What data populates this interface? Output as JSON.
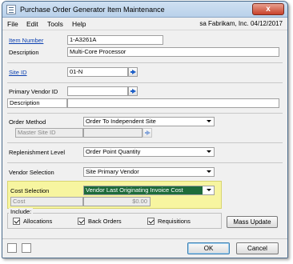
{
  "window": {
    "title": "Purchase Order Generator Item Maintenance",
    "close_label": "x"
  },
  "menu": {
    "items": [
      "File",
      "Edit",
      "Tools",
      "Help"
    ],
    "company_info": "sa  Fabrikam, Inc.  04/12/2017"
  },
  "form": {
    "item_number_label": "Item Number",
    "item_number_value": "1-A3261A",
    "description_label": "Description",
    "description_value": "Multi-Core Processor",
    "site_id_label": "Site ID",
    "site_id_value": "01-N",
    "primary_vendor_label": "Primary Vendor ID",
    "primary_vendor_value": "",
    "vendor_description_label": "Description",
    "vendor_description_value": "",
    "order_method_label": "Order Method",
    "order_method_value": "Order To Independent Site",
    "master_site_label": "Master Site ID",
    "master_site_value": "",
    "replenishment_label": "Replenishment Level",
    "replenishment_value": "Order Point Quantity",
    "vendor_selection_label": "Vendor Selection",
    "vendor_selection_value": "Site Primary Vendor",
    "cost_selection_label": "Cost Selection",
    "cost_selection_value": "Vendor Last Originating Invoice Cost",
    "cost_label": "Cost",
    "cost_value": "$0.00"
  },
  "include": {
    "label": "Include:",
    "allocations": "Allocations",
    "back_orders": "Back Orders",
    "requisitions": "Requisitions",
    "allocations_checked": true,
    "back_orders_checked": true,
    "requisitions_checked": true
  },
  "buttons": {
    "mass_update": "Mass Update",
    "ok": "OK",
    "cancel": "Cancel"
  },
  "colors": {
    "highlight": "#f7f5a0",
    "selection": "#1e6b3a",
    "link": "#0a3fb0"
  }
}
